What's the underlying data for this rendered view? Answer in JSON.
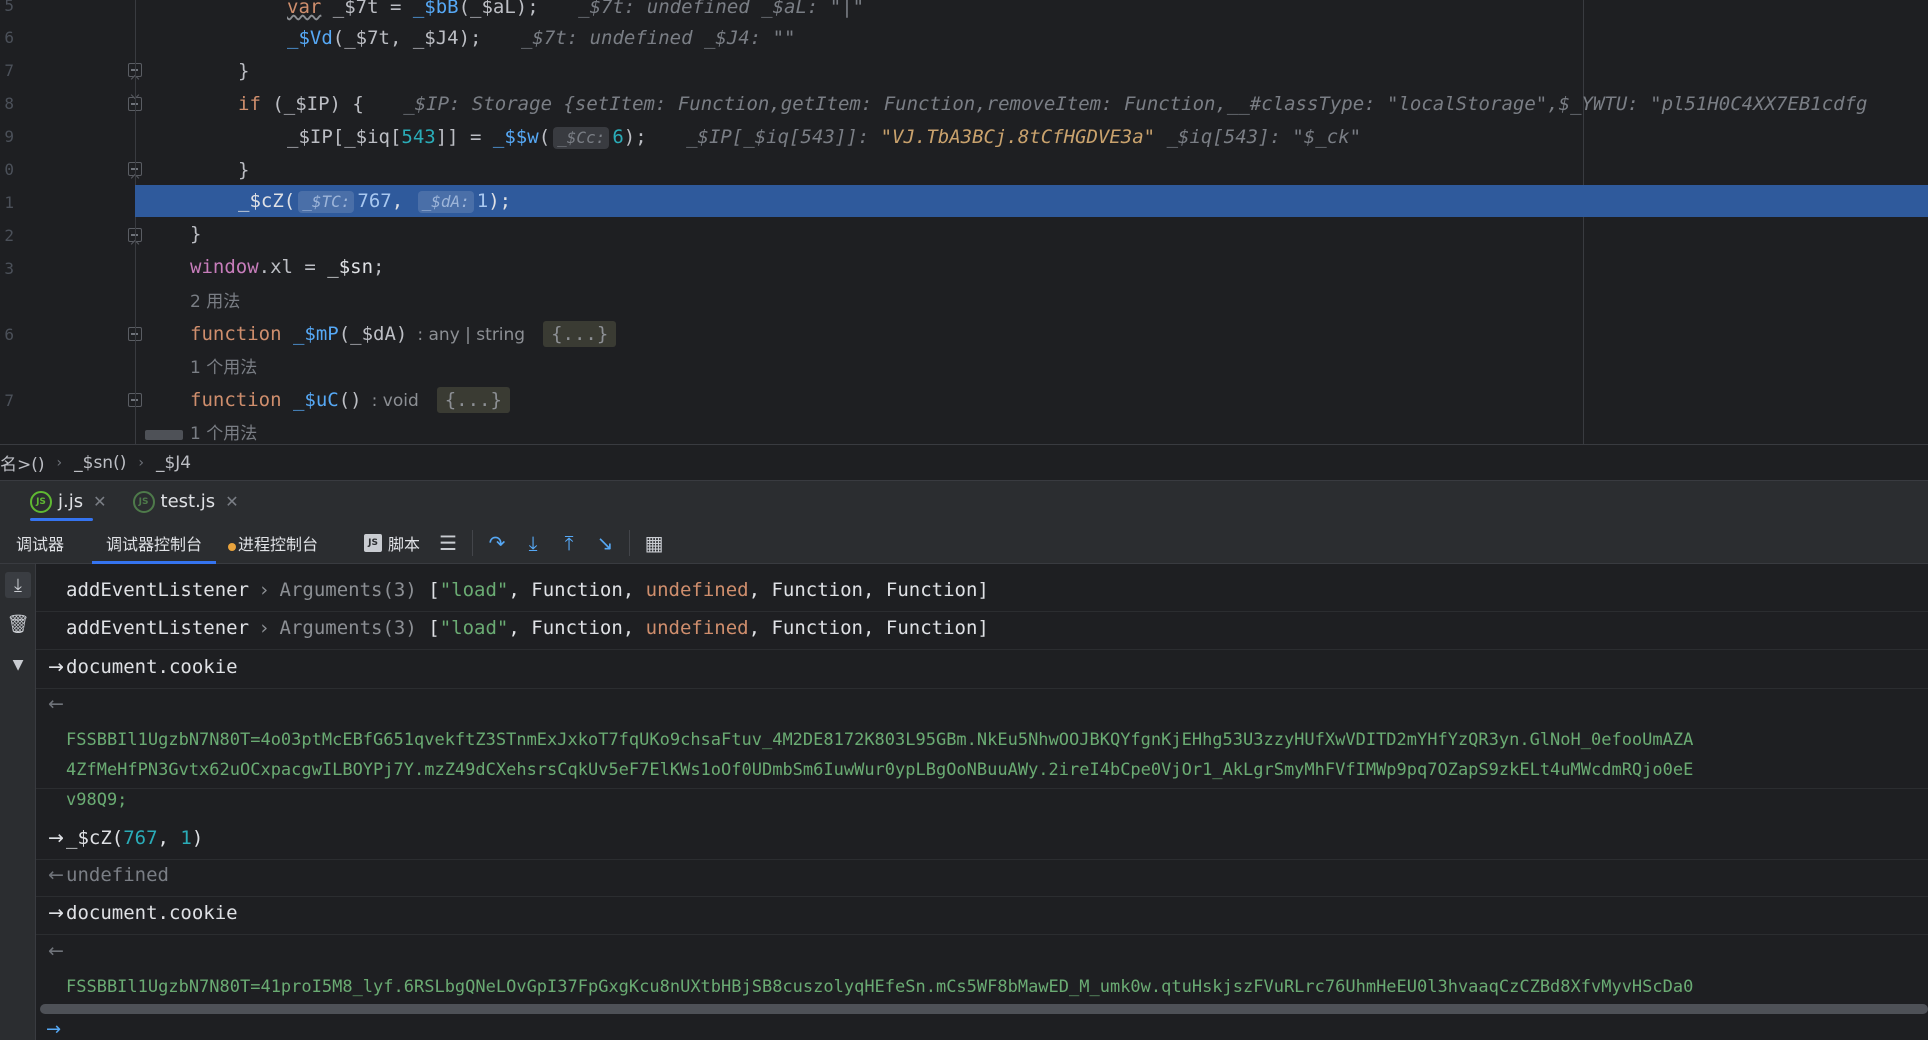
{
  "editor": {
    "line_numbers": [
      "5",
      "6",
      "7",
      "8",
      "9",
      "0",
      "1",
      "2",
      "3",
      "",
      "6",
      "",
      "7",
      ""
    ],
    "lines": {
      "l1": {
        "var": "var",
        "a": " _$7t = ",
        "fn": "_$bB",
        "b": "(_$aL);",
        "hint": "_$7t: undefined    _$aL: \"|\""
      },
      "l2": {
        "fn": "_$Vd",
        "a": "(_$7t, _$J4);",
        "hint": "_$7t: undefined    _$J4: \"\""
      },
      "l3": {
        "a": "}"
      },
      "l4": {
        "kw": "if",
        "a": " (_$IP) {",
        "hint": "_$IP: Storage {setItem: Function,getItem: Function,removeItem: Function,__#classType: \"localStorage\",$_YWTU: \"pl51H0C4XX7EB1cdfg"
      },
      "l5": {
        "a": "_$IP[_$iq[",
        "num": "543",
        "b": "]] = ",
        "fn": "_$$w",
        "c": "(",
        "chip": "_$Cc:",
        "num2": "6",
        "d": ");",
        "hint1": "_$IP[_$iq[543]]: ",
        "hintval": "\"VJ.TbA3BCj.8tCfHGDVE3a\"",
        "hint2": "    _$iq[543]: \"$_ck\""
      },
      "l6": {
        "a": "}"
      },
      "l7": {
        "fn": "_$cZ",
        "a": "(",
        "chip1": "_$TC:",
        "num1": "767",
        "sep": ", ",
        "chip2": "_$dA:",
        "num2": "1",
        "b": ");"
      },
      "l8": {
        "a": "}"
      },
      "l9": {
        "kw": "window",
        "a": ".xl = ",
        "fn": "_$sn",
        "b": ";"
      },
      "u1": "2 用法",
      "l10": {
        "kw": "function",
        "fn": "_$mP",
        "a": "(_$dA)",
        "type": ": any | string",
        "folded": "{...}"
      },
      "u2": "1 个用法",
      "l11": {
        "kw": "function",
        "fn": "_$uC",
        "a": "()",
        "type": ": void",
        "folded": "{...}"
      },
      "u3": "1 个用法"
    }
  },
  "breadcrumb": {
    "items": [
      "名>()",
      "_$sn()",
      "_$J4"
    ]
  },
  "tabs": [
    {
      "label": "j.js",
      "icon": "JS"
    },
    {
      "label": "test.js",
      "icon": "JS"
    }
  ],
  "debug_toolbar": {
    "tabs": [
      "调试器",
      "调试器控制台",
      "进程控制台"
    ],
    "script_label": "脚本"
  },
  "console": {
    "rows": [
      {
        "name": "addEventListener",
        "args": "Arguments(3)",
        "arr_open": "[",
        "s1": "\"load\"",
        "f1": ", Function, ",
        "und": "undefined",
        "f2": ", Function, Function]"
      },
      {
        "name": "addEventListener",
        "args": "Arguments(3)",
        "arr_open": "[",
        "s1": "\"load\"",
        "f1": ", Function, ",
        "und": "undefined",
        "f2": ", Function, Function]"
      }
    ],
    "input1": "document.cookie",
    "cookie1_l1": "FSSBBIl1UgzbN7N80T=4o03ptMcEBfG651qvekftZ3STnmExJxkoT7fqUKo9chsaFtuv_4M2DE8172K803L95GBm.NkEu5NhwOOJBKQYfgnKjEHhg53U3zzyHUfXwVDITD2mYHfYzQR3yn.GlNoH_0efooUmAZA",
    "cookie1_l2": "4ZfMeHfPN3Gvtx62uOCxpacgwILBOYPj7Y.mzZ49dCXehsrsCqkUv5eF7ElKWs1oOf0UDmbSm6IuwWur0ypLBgOoNBuuAWy.2ireI4bCpe0VjOr1_AkLgrSmyMhFVfIMWp9pq7OZapS9zkELt4uMWcdmRQjo0eE",
    "cookie1_l3": "v98Q9;",
    "input2_fn": "_$cZ(",
    "input2_n1": "767",
    "input2_sep": ", ",
    "input2_n2": "1",
    "input2_end": ")",
    "result2": "undefined",
    "input3": "document.cookie",
    "cookie2_l1": "FSSBBIl1UgzbN7N80T=41proI5M8_lyf.6RSLbgQNeLOvGpI37FpGxgKcu8nUXtbHBjSB8cuszolyqHEfeSn.mCs5WF8bMawED_M_umk0w.qtuHskjszFVuRLrc76UhmHeEU0l3hvaaqCzCZBd8XfvMyvHScDa0"
  },
  "colors": {
    "accent": "#3574f0",
    "selection": "#2f5a9c",
    "string": "#6aab73",
    "keyword": "#cf8e6d",
    "function": "#56a8f5",
    "number": "#2aacb8"
  }
}
